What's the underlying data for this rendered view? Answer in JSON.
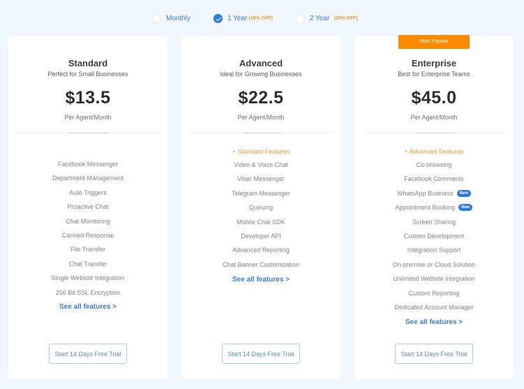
{
  "billing": {
    "options": [
      {
        "label": "Monthly",
        "discount": "",
        "selected": false
      },
      {
        "label": "1 Year",
        "discount": "(10% OFF)",
        "selected": true
      },
      {
        "label": "2 Year",
        "discount": "(20% OFF)",
        "selected": false
      }
    ]
  },
  "colors": {
    "accent": "#3a7be0",
    "highlight": "#fb8c00",
    "background": "#f0f7fd"
  },
  "plans": [
    {
      "name": "Standard",
      "subtitle": "Perfect for Small Businesses",
      "price": "$13.5",
      "unit": "Per Agent/Month",
      "inherits": "",
      "features": [
        {
          "label": "Facebook Messenger"
        },
        {
          "label": "Department Management"
        },
        {
          "label": "Auto Triggers"
        },
        {
          "label": "Proactive Chat"
        },
        {
          "label": "Chat Monitoring"
        },
        {
          "label": "Canned Response"
        },
        {
          "label": "File Transfer"
        },
        {
          "label": "Chat Transfer"
        },
        {
          "label": "Single Website Integration"
        },
        {
          "label": "256 Bit SSL Encryption"
        }
      ],
      "see_all": "See all features >",
      "cta": "Start 14 Days Free Trial"
    },
    {
      "name": "Advanced",
      "subtitle": "Ideal for Growing Businesses",
      "price": "$22.5",
      "unit": "Per Agent/Month",
      "inherits": "+ Standard Features",
      "features": [
        {
          "label": "Video & Voice Chat"
        },
        {
          "label": "Viber Messenger"
        },
        {
          "label": "Telegram Messenger"
        },
        {
          "label": "Queuing"
        },
        {
          "label": "Mobile Chat SDK"
        },
        {
          "label": "Developer API"
        },
        {
          "label": "Advanced Reporting"
        },
        {
          "label": "Chat Banner Customization"
        }
      ],
      "see_all": "See all features >",
      "cta": "Start 14 Days Free Trial"
    },
    {
      "name": "Enterprise",
      "badge": "Most Popular",
      "subtitle": "Best for Enterprise Teams",
      "price": "$45.0",
      "unit": "Per Agent/Month",
      "inherits": "+ Advanced Features",
      "features": [
        {
          "label": "Co-browsing"
        },
        {
          "label": "Facebook Comments"
        },
        {
          "label": "WhatsApp Business",
          "tag": "New"
        },
        {
          "label": "Appointment Booking",
          "tag": "New"
        },
        {
          "label": "Screen Sharing"
        },
        {
          "label": "Custom Development"
        },
        {
          "label": "Integration Support"
        },
        {
          "label": "On-premise or Cloud Solution"
        },
        {
          "label": "Unlimited Website Integration"
        },
        {
          "label": "Custom Reporting"
        },
        {
          "label": "Dedicated Account Manager"
        }
      ],
      "see_all": "See all features >",
      "cta": "Start 14 Days Free Trial"
    }
  ]
}
